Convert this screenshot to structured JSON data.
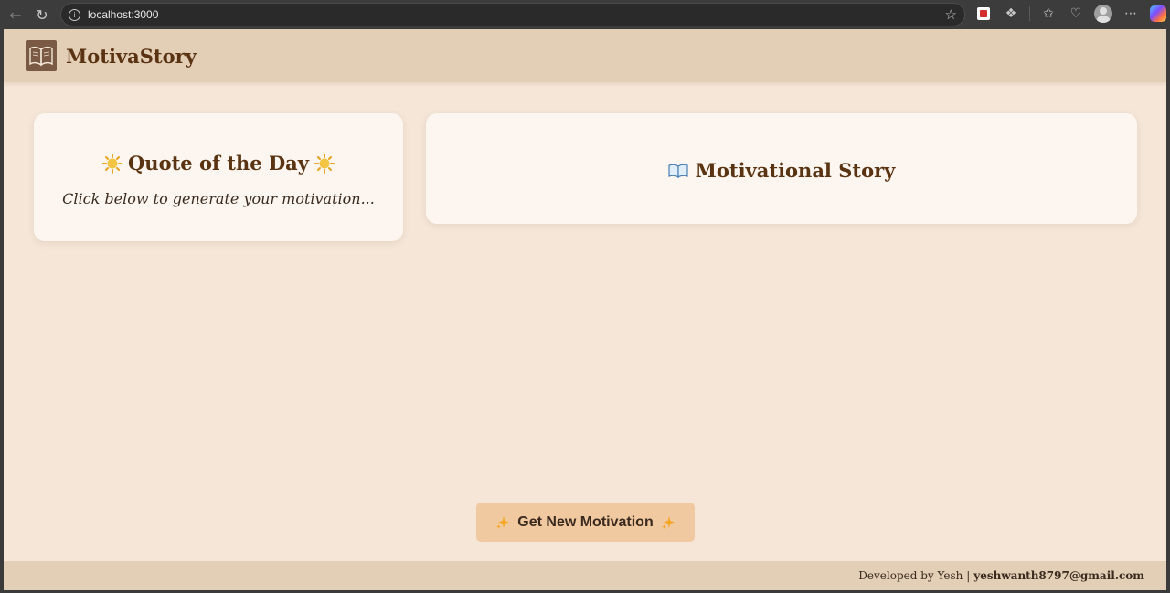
{
  "browser": {
    "url": "localhost:3000"
  },
  "header": {
    "title": "MotivaStory",
    "logo_icon": "open-book-icon"
  },
  "quote_card": {
    "heading": "Quote of the Day",
    "icon": "sun-emoji",
    "placeholder_text": "Click below to generate your motivation..."
  },
  "story_card": {
    "heading": "Motivational Story",
    "icon": "open-book-emoji"
  },
  "action": {
    "button_label": "Get New Motivation",
    "icon": "sparkles-emoji",
    "color": "#f1c9a0"
  },
  "footer": {
    "developed_by": "Developed by Yesh |",
    "email": "yeshwanth8797@gmail.com"
  },
  "colors": {
    "page_background": "#f5e6d8",
    "header_background": "#e3ceb6",
    "card_background": "#fdf6f0",
    "title_color": "#5a3412"
  }
}
